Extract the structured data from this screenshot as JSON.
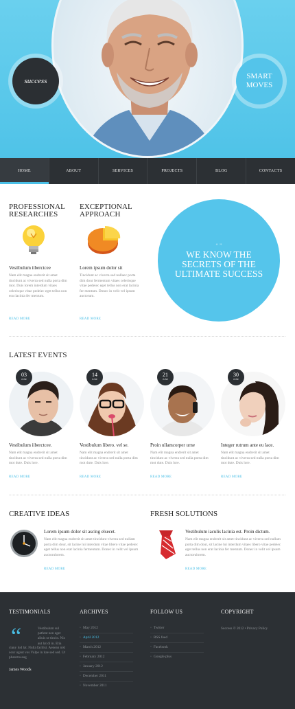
{
  "hero": {
    "badge_left": "success",
    "badge_right": "SMART MOVES"
  },
  "nav": [
    "HOME",
    "ABOUT",
    "SERVICES",
    "PROJECTS",
    "BLOG",
    "CONTACTS"
  ],
  "features": [
    {
      "title_l1": "PROFESSIONAL",
      "title_l2": "RESEARCHES",
      "icon": "lightbulb-icon",
      "subtitle": "Vestibulum iiberctcee",
      "text": "Nam elit magna endrerit sit amet tincidunt ac viverra sed nulla porta dim mot. Duis lorem interdum vitaes celerisque vitae pedeiec eget tellus non erat lacinia fer mentum.",
      "read_more": "READ MORE"
    },
    {
      "title_l1": "EXCEPTIONAL",
      "title_l2": "APPROACH",
      "icon": "pie-chart-icon",
      "subtitle": "Lorem ipsum dolor sit",
      "text": "Tincidunt ac viverra sed nullaec porta dim dour fermentum vitaes celerisque vitae pedeiec eget tellus non erat lacinia fer mentum. Donec in velit vel ipsum auctorum.",
      "read_more": "READ MORE"
    }
  ],
  "big_circle": {
    "quote_mark": "“ ”",
    "text": "WE KNOW THE SECRETS OF THE ULTIMATE SUCCESS"
  },
  "events_title": "LATEST EVENTS",
  "events": [
    {
      "day": "03",
      "month": "JUNE",
      "title": "Vestibulum iiberctcee.",
      "text": "Nam elit magna endrerit sit amet tincidunt ac viverra sed nulla porta dim mot dute. Duis lore.",
      "read_more": "READ MORE"
    },
    {
      "day": "14",
      "month": "JUNE",
      "title": "Vestibulum libero. vel se.",
      "text": "Nam elit magna endrerit sit amet tincidunt ac viverra sed nulla porta dim mot dute. Duis lore.",
      "read_more": "READ MORE"
    },
    {
      "day": "21",
      "month": "JUNE",
      "title": "Proin ullamcorper urne",
      "text": "Nam elit magna endrerit sit amet tincidunt ac viverra sed nulla porta dim mot dute. Duis lore.",
      "read_more": "READ MORE"
    },
    {
      "day": "30",
      "month": "JUNE",
      "title": "Integer rutrum ante eu lace.",
      "text": "Nam elit magna endrerit sit amet tincidunt ac viverra sed nulla porta dim mot dute. Duis lore.",
      "read_more": "READ MORE"
    }
  ],
  "creative": {
    "title": "CREATIVE IDEAS",
    "subtitle": "Lorem ipsum dolor sit ascing elsecet.",
    "text": "Nam elit magna endrerit sit amet tincidunt viverra sed nullam porta dim dour, sit lacine lui interdum vitae libero vitae pedeiec eget tellus non erat lacinia fermentum. Donec in velit vel ipsum auctorulorem.",
    "read_more": "READ MORE"
  },
  "fresh": {
    "title": "FRESH SOLUTIONS",
    "subtitle": "Vestibulum iaculis lacinia est. Proin dictum.",
    "text": "Nam elit magna endrerit sit amet tincidunt ac viverra sed nullam porta dim dour, sit lacine lui interdum vitaes libero vitae pedeiec eget tellus non erat lacinia fer mentum. Donec in velit vel ipsum auctorulorem.",
    "read_more": "READ MORE"
  },
  "footer": {
    "testimonials_title": "TESTIMONIALS",
    "testimonial_text_short": "Vestibulum sul pathrat non eget aliuis se tincin. Nis aut lat di in. Etia",
    "testimonial_text_full": "ciany lud lat. Nulla facilisi. Aenean nisl ocur ugsut vos Vulpe in itae sed sed. Ut pharetra aug",
    "testimonial_author": "James Woods",
    "archives_title": "ARCHIVES",
    "archives": [
      "May 2012",
      "April 2012",
      "March 2012",
      "February 2012",
      "January 2012",
      "December 2011",
      "November 2011"
    ],
    "follow_title": "FOLLOW US",
    "follow": [
      "Twitter",
      "RSS feed",
      "Facebook",
      "Google plus"
    ],
    "copyright_title": "COPYRIGHT",
    "copyright_text": "Success © 2012 • Privacy Policy"
  },
  "colors": {
    "accent": "#49bfe6",
    "dark": "#2c3034",
    "hero_bg": "#55c5eb"
  }
}
